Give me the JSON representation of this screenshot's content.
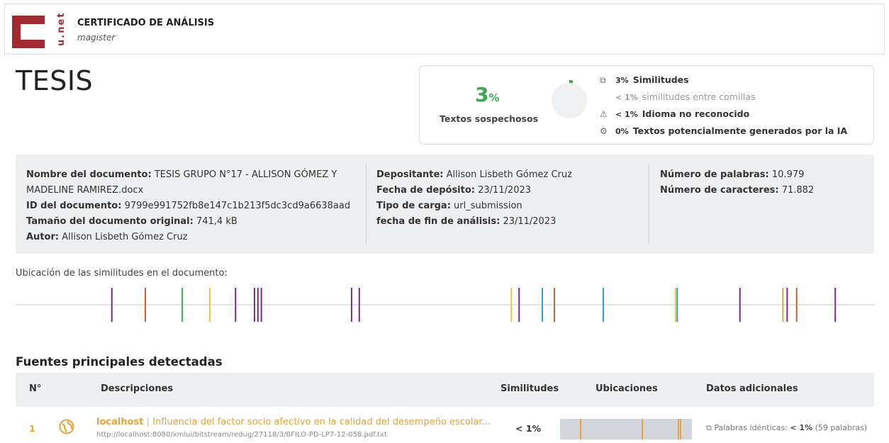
{
  "header": {
    "logo_text": "u.net",
    "title": "CERTIFICADO DE ANÁLISIS",
    "subtitle": "magister"
  },
  "document_title": "TESIS",
  "summary": {
    "percent_value": "3",
    "percent_sign": "%",
    "percent_label": "Textos sospechosos",
    "donut_fraction": 0.03,
    "colors": {
      "accent_green": "#3aab4b",
      "donut_bg": "#eef0f2"
    },
    "stats": [
      {
        "icon": "copy-icon",
        "value": "3%",
        "label": "Similitudes"
      },
      {
        "icon": "",
        "value": "< 1%",
        "label": "similitudes entre comillas"
      },
      {
        "icon": "language-warning-icon",
        "value": "< 1%",
        "label": "Idioma no reconocido"
      },
      {
        "icon": "ai-chip-icon",
        "value": "0%",
        "label": "Textos potencialmente generados por la IA"
      }
    ]
  },
  "info": {
    "col1": {
      "name_label": "Nombre del documento:",
      "name_value": "TESIS GRUPO N°17 - ALLISON GÓMEZ Y",
      "name_value_cont": "MADELINE RAMIREZ.docx",
      "id_label": "ID del documento:",
      "id_value": "9799e991752fb8e147c1b213f5dc3cd9a6638aad",
      "size_label": "Tamaño del documento original:",
      "size_value": "741,4 kB",
      "author_label": "Autor:",
      "author_value": "Allison Lisbeth Gómez Cruz"
    },
    "col2": {
      "depositor_label": "Depositante:",
      "depositor_value": "Allison Lisbeth Gómez Cruz",
      "date_label": "Fecha de depósito:",
      "date_value": "23/11/2023",
      "upload_label": "Tipo de carga:",
      "upload_value": "url_submission",
      "end_label": "fecha de fin de análisis:",
      "end_value": "23/11/2023"
    },
    "col3": {
      "words_label": "Número de palabras:",
      "words_value": "10.979",
      "chars_label": "Número de caracteres:",
      "chars_value": "71.882"
    }
  },
  "locations": {
    "label": "Ubicación de las similitudes en el documento:",
    "marks": [
      {
        "pos": 0.112,
        "color": "#7b2a8c"
      },
      {
        "pos": 0.151,
        "color": "#c0662e"
      },
      {
        "pos": 0.194,
        "color": "#3aab4b"
      },
      {
        "pos": 0.226,
        "color": "#e8c83d"
      },
      {
        "pos": 0.256,
        "color": "#7b2a8c"
      },
      {
        "pos": 0.278,
        "color": "#7b2a8c"
      },
      {
        "pos": 0.282,
        "color": "#7b2a8c"
      },
      {
        "pos": 0.286,
        "color": "#7b2a8c"
      },
      {
        "pos": 0.391,
        "color": "#7b2a8c"
      },
      {
        "pos": 0.4,
        "color": "#7b2a8c"
      },
      {
        "pos": 0.577,
        "color": "#e8c83d"
      },
      {
        "pos": 0.586,
        "color": "#7b2a8c"
      },
      {
        "pos": 0.613,
        "color": "#2f9fd0"
      },
      {
        "pos": 0.627,
        "color": "#c0662e"
      },
      {
        "pos": 0.684,
        "color": "#2f9fd0"
      },
      {
        "pos": 0.768,
        "color": "#e8c83d"
      },
      {
        "pos": 0.77,
        "color": "#2f9fd0"
      },
      {
        "pos": 0.843,
        "color": "#7b2a8c"
      },
      {
        "pos": 0.893,
        "color": "#e8a33d"
      },
      {
        "pos": 0.898,
        "color": "#7b2a8c"
      },
      {
        "pos": 0.909,
        "color": "#c0662e"
      },
      {
        "pos": 0.954,
        "color": "#7b2a8c"
      }
    ]
  },
  "sources": {
    "title": "Fuentes principales detectadas",
    "columns": {
      "num": "N°",
      "desc": "Descripciones",
      "sim": "Similitudes",
      "loc": "Ubicaciones",
      "extra": "Datos adicionales"
    },
    "rows": [
      {
        "num": "1",
        "icon": "globe-icon",
        "source": "localhost",
        "separator": " | ",
        "title": "Influencia del factor socio afectivo en la calidad del desempeño escolar...",
        "url": "http://localhost:8080/xmlui/bitstream/redug/27118/3/BFILO-PD-LP7-12-058.pdf.txt",
        "similarity": "< 1%",
        "marks": [
          0.15,
          0.62,
          0.89,
          0.91
        ],
        "extra_label": "Palabras idénticas:",
        "extra_value": "< 1%",
        "extra_count": "(59 palabras)"
      }
    ]
  }
}
